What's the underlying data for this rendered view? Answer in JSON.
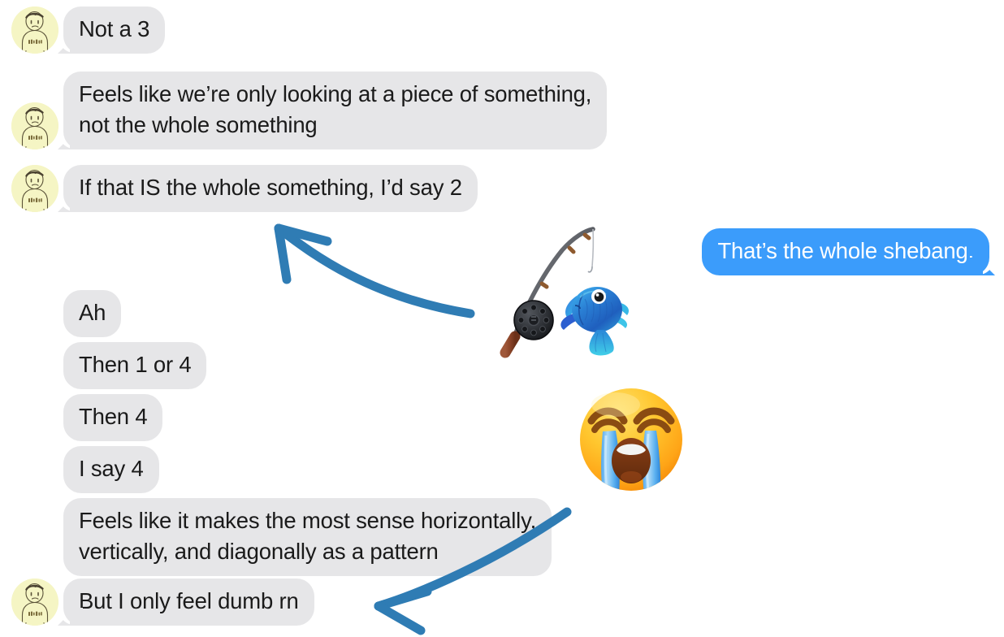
{
  "app": {
    "kind": "imessage-thread-screenshot",
    "background_color": "#ffffff",
    "incoming_bubble_color": "#e6e6e8",
    "incoming_text_color": "#1a1a1a",
    "outgoing_bubble_color": "#3b9cfb",
    "outgoing_text_color": "#ffffff",
    "annotation_color": "#2f7cb4",
    "avatar_color": "#f5f5c4"
  },
  "messages": [
    {
      "id": "msg-1",
      "side": "incoming",
      "text": "Not a 3",
      "avatar": true,
      "tail": true
    },
    {
      "id": "msg-2",
      "side": "incoming",
      "text": "Feels like we’re only looking at a piece of something,\nnot the whole something",
      "avatar": true,
      "tail": true
    },
    {
      "id": "msg-3",
      "side": "incoming",
      "text": "If that IS the whole something, I’d say 2",
      "avatar": true,
      "tail": true
    },
    {
      "id": "msg-4",
      "side": "outgoing",
      "text": "That’s the whole shebang.",
      "avatar": false,
      "tail": true
    },
    {
      "id": "msg-5",
      "side": "incoming",
      "text": "Ah",
      "avatar": false,
      "tail": false
    },
    {
      "id": "msg-6",
      "side": "incoming",
      "text": "Then 1 or 4",
      "avatar": false,
      "tail": false
    },
    {
      "id": "msg-7",
      "side": "incoming",
      "text": "Then 4",
      "avatar": false,
      "tail": false
    },
    {
      "id": "msg-8",
      "side": "incoming",
      "text": "I say 4",
      "avatar": false,
      "tail": false
    },
    {
      "id": "msg-9",
      "side": "incoming",
      "text": "Feels like it makes the most sense horizontally,\nvertically, and diagonally as a pattern",
      "avatar": false,
      "tail": false
    },
    {
      "id": "msg-10",
      "side": "incoming",
      "text": "But I only feel dumb rn",
      "avatar": true,
      "tail": true
    }
  ],
  "stickers": [
    {
      "id": "sticker-fishing-pole",
      "icon_name": "fishing-pole-and-fish-emoji",
      "glyph": "🎣",
      "label": "fishing pole with blue fish"
    },
    {
      "id": "sticker-crying-face",
      "icon_name": "loudly-crying-face-emoji",
      "glyph": "😭",
      "label": "loudly crying face"
    }
  ],
  "annotations": [
    {
      "id": "annotation-arrow-upper",
      "icon_name": "curved-arrow-up-left-icon",
      "label": "hand drawn arrow pointing up-left at the “If that IS the whole something, I’d say 2” bubble",
      "color": "#2f7cb4"
    },
    {
      "id": "annotation-arrow-lower",
      "icon_name": "curved-arrow-down-left-icon",
      "label": "hand drawn arrow pointing down-left at the “But I only feel dumb rn” bubble",
      "color": "#2f7cb4"
    }
  ],
  "avatar": {
    "icon_name": "doodle-person-avatar",
    "label": "yellow circle with hand drawn person wearing a shirt with scribbled text",
    "shirt_text": "scribble"
  }
}
